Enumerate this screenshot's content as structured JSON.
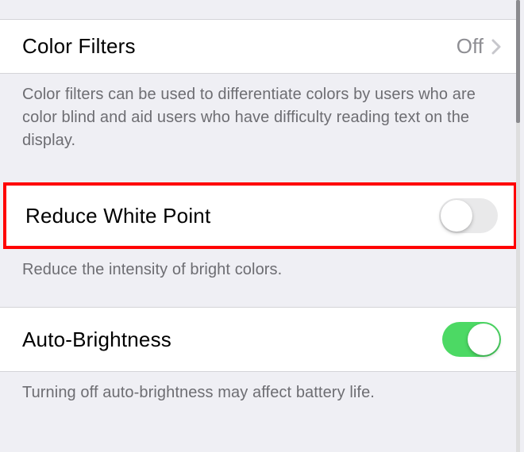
{
  "sections": {
    "colorFilters": {
      "title": "Color Filters",
      "value": "Off",
      "description": "Color filters can be used to differentiate colors by users who are color blind and aid users who have difficulty reading text on the display."
    },
    "reduceWhitePoint": {
      "title": "Reduce White Point",
      "toggleOn": false,
      "description": "Reduce the intensity of bright colors."
    },
    "autoBrightness": {
      "title": "Auto-Brightness",
      "toggleOn": true,
      "description": "Turning off auto-brightness may affect battery life."
    }
  },
  "colors": {
    "highlight": "#ff0000",
    "toggleOn": "#4cd964",
    "background": "#efeff4"
  }
}
